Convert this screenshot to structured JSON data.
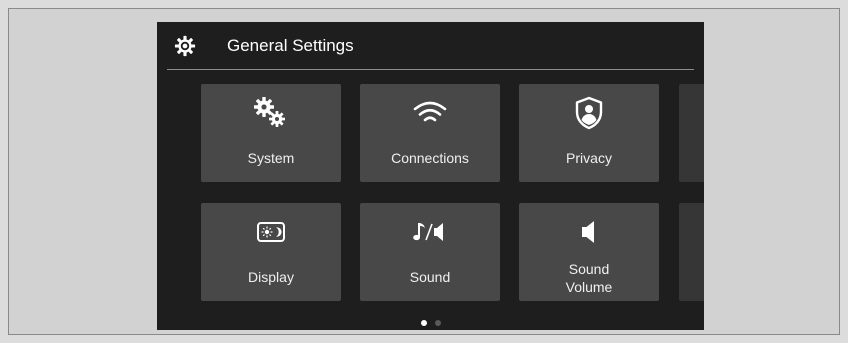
{
  "header": {
    "icon": "gear-icon",
    "title": "General Settings"
  },
  "tiles": [
    {
      "label": "System",
      "icon": "gears-icon"
    },
    {
      "label": "Connections",
      "icon": "wifi-icon"
    },
    {
      "label": "Privacy",
      "icon": "privacy-shield-icon"
    },
    {
      "label": "Display",
      "icon": "display-day-night-icon"
    },
    {
      "label": "Sound",
      "icon": "sound-note-speaker-icon"
    },
    {
      "label_line1": "Sound",
      "label_line2": "Volume",
      "icon": "speaker-icon"
    }
  ],
  "pagination": {
    "current_page": 1,
    "total_pages": 2
  },
  "colors": {
    "screen_bg": "#1e1e1e",
    "tile_bg": "#484848",
    "text": "#ffffff",
    "dot_active": "#ffffff",
    "dot_inactive": "#5a5a5a"
  }
}
